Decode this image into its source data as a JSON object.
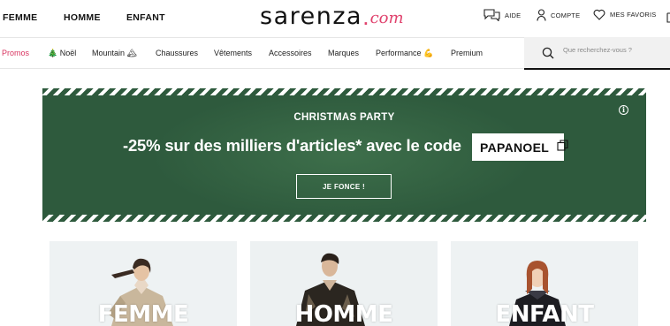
{
  "header": {
    "genders": [
      "FEMME",
      "HOMME",
      "ENFANT"
    ],
    "logo": {
      "brand": "sarenza",
      "dot": ".",
      "suffix": "com"
    },
    "tools": {
      "help": "AIDE",
      "account": "COMPTE",
      "favorites": "MES FAVORIS"
    }
  },
  "nav": {
    "items": [
      "Promos",
      "🎄 Noël",
      "Mountain 🏔",
      "Chaussures",
      "Vêtements",
      "Accessoires",
      "Marques",
      "Performance 💪",
      "Premium"
    ],
    "search_placeholder": "Que recherchez-vous ?"
  },
  "banner": {
    "kicker": "CHRISTMAS PARTY",
    "headline": "-25% sur des milliers d'articles* avec le code",
    "code": "PAPANOEL",
    "cta": "JE FONCE !",
    "info": "i"
  },
  "categories": [
    {
      "label": "FEMME"
    },
    {
      "label": "HOMME"
    },
    {
      "label": "ENFANT"
    }
  ],
  "colors": {
    "accent": "#e0426d",
    "promo": "#d8335f",
    "banner_green": "#2e5a3d",
    "card_bg": "#eef2f3"
  }
}
